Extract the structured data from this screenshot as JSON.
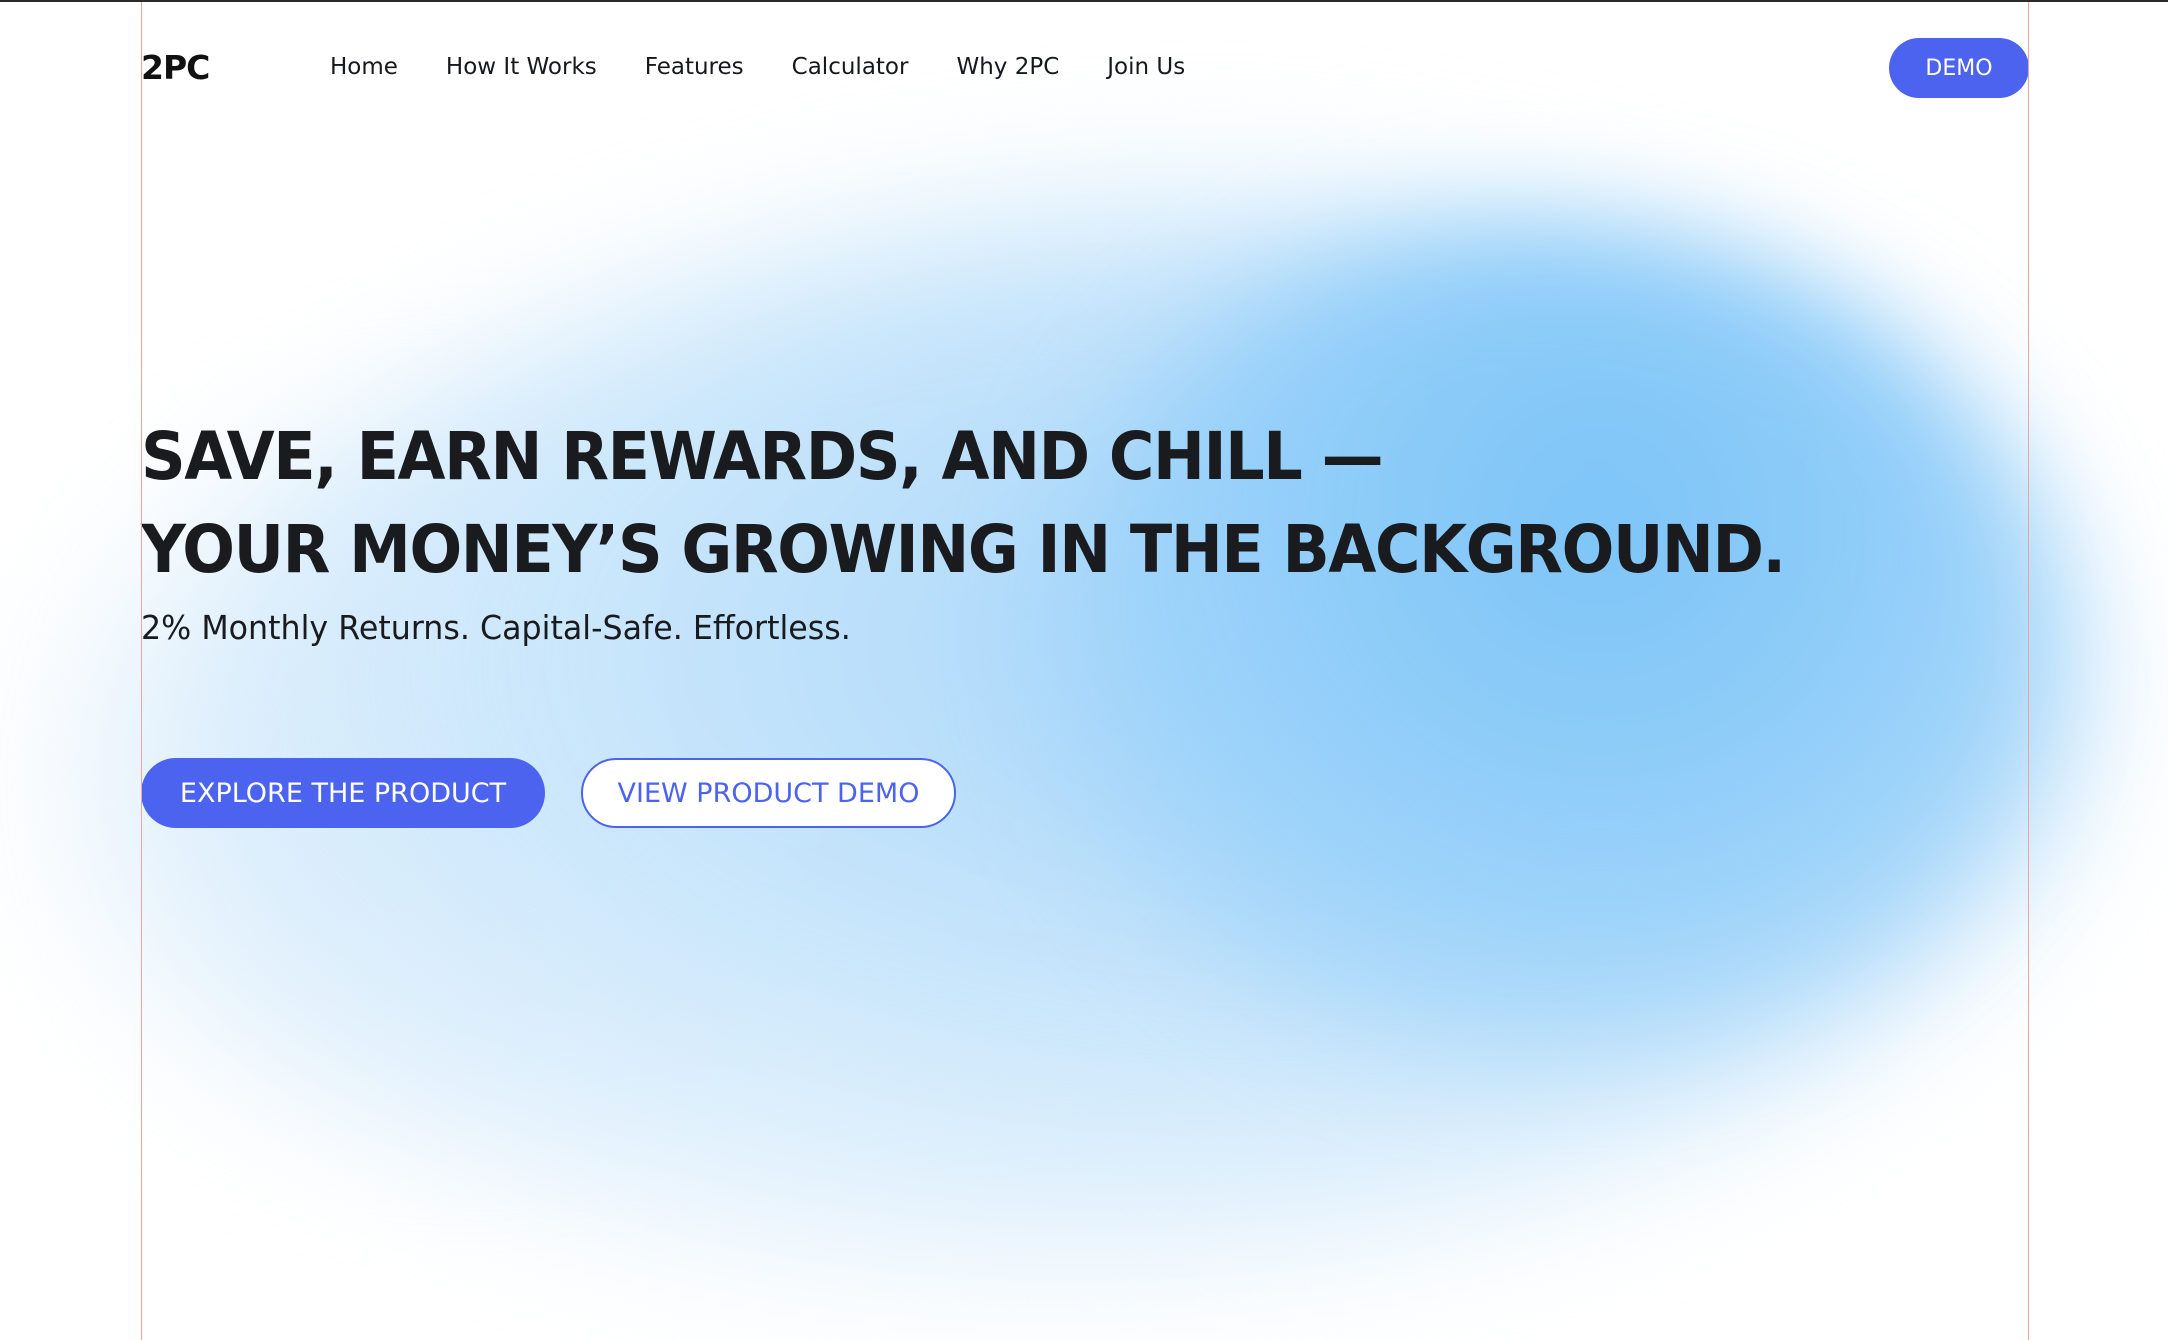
{
  "brand": {
    "logo_text": "2PC"
  },
  "nav": {
    "items": [
      {
        "label": "Home"
      },
      {
        "label": "How It Works"
      },
      {
        "label": "Features"
      },
      {
        "label": "Calculator"
      },
      {
        "label": "Why 2PC"
      },
      {
        "label": "Join Us"
      }
    ],
    "demo_label": "DEMO"
  },
  "hero": {
    "headline_line1": "SAVE, EARN REWARDS, AND CHILL —",
    "headline_line2": "YOUR MONEY’S GROWING IN THE BACKGROUND.",
    "subheadline": "2% Monthly Returns. Capital-Safe. Effortless.",
    "primary_cta": "EXPLORE THE PRODUCT",
    "secondary_cta": "VIEW PRODUCT DEMO"
  },
  "colors": {
    "accent": "#4b63ee",
    "text": "#1a1b1f",
    "glow": "#7cc4f8",
    "guide_line": "#e8a69c"
  }
}
